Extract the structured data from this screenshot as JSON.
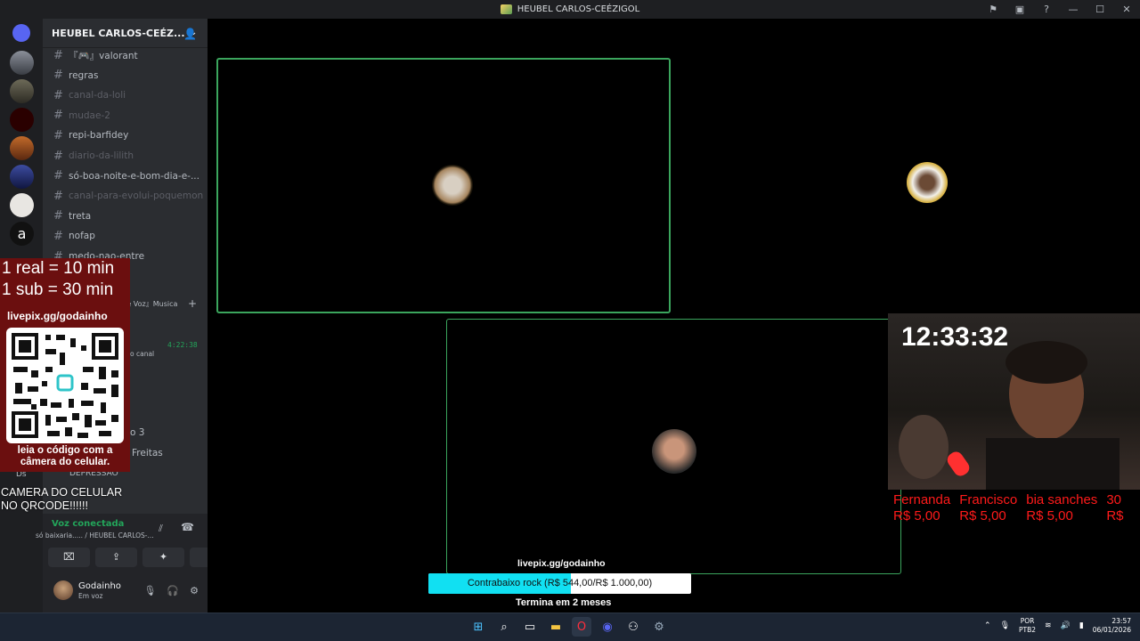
{
  "window": {
    "title": "HEUBEL CARLOS-CEÉZIGOL",
    "controls": [
      "⚑",
      "▣",
      "?",
      "—",
      "☐",
      "✕"
    ]
  },
  "sidebar": {
    "server_name": "HEUBEL CARLOS-CEÉZ...",
    "channels": [
      {
        "name": "『🎮』valorant",
        "muted": false
      },
      {
        "name": "regras",
        "muted": false
      },
      {
        "name": "canal-da-loli",
        "muted": true
      },
      {
        "name": "mudae-2",
        "muted": true
      },
      {
        "name": "repi-barfidey",
        "muted": false
      },
      {
        "name": "diario-da-lilith",
        "muted": true
      },
      {
        "name": "só-boa-noite-e-bom-dia-e-...",
        "muted": false
      },
      {
        "name": "canal-para-evolui-poquemon",
        "muted": true
      },
      {
        "name": "treta",
        "muted": false
      },
      {
        "name": "nofap",
        "muted": false
      },
      {
        "name": "medo-nao-entre",
        "muted": false
      }
    ],
    "category_partial": "『Chat de Voz』Musica",
    "voice_time": "4:22:38",
    "partial_items": [
      "o canal",
      "o 3",
      "Freitas",
      "DEPRESSÃO",
      "Ds"
    ],
    "voice_status": "Voz conectada",
    "voice_sub": "só baixaria..... / HEUBEL CARLOS-...",
    "username": "Godainho",
    "user_status": "Em voz"
  },
  "overlay": {
    "rate_line1": "1 real = 10 min",
    "rate_line2": "1 sub = 30 min",
    "qr_url": "livepix.gg/godainho",
    "qr_caption": "leia o código com a câmera do celular.",
    "camera_line1": "CAMERA DO CELULAR",
    "camera_line2": "NO QRCODE!!!!!!",
    "clock": "12:33:32",
    "donors": [
      {
        "name": "Fernanda",
        "amount": "R$ 5,00"
      },
      {
        "name": "Francisco",
        "amount": "R$ 5,00"
      },
      {
        "name": "bia sanches",
        "amount": "R$ 5,00"
      },
      {
        "name": "30",
        "amount": "R$"
      }
    ],
    "goal_url": "livepix.gg/godainho",
    "goal_text": "Contrabaixo rock (R$ 544,00/R$ 1.000,00)",
    "goal_progress": 0.544,
    "goal_end": "Termina em 2 meses"
  },
  "taskbar": {
    "lang": "POR",
    "layout": "PTB2",
    "time": "23:57",
    "date": "06/01/2026"
  },
  "colors": {
    "tile1_bg": "#d2b39f",
    "tile2_bg": "#c8c6c1",
    "tile3_bg": "#4a4d47",
    "speaking_border": "#3ba55d",
    "goal_fill": "#11e0f2",
    "donor_red": "#ff1a1a"
  }
}
